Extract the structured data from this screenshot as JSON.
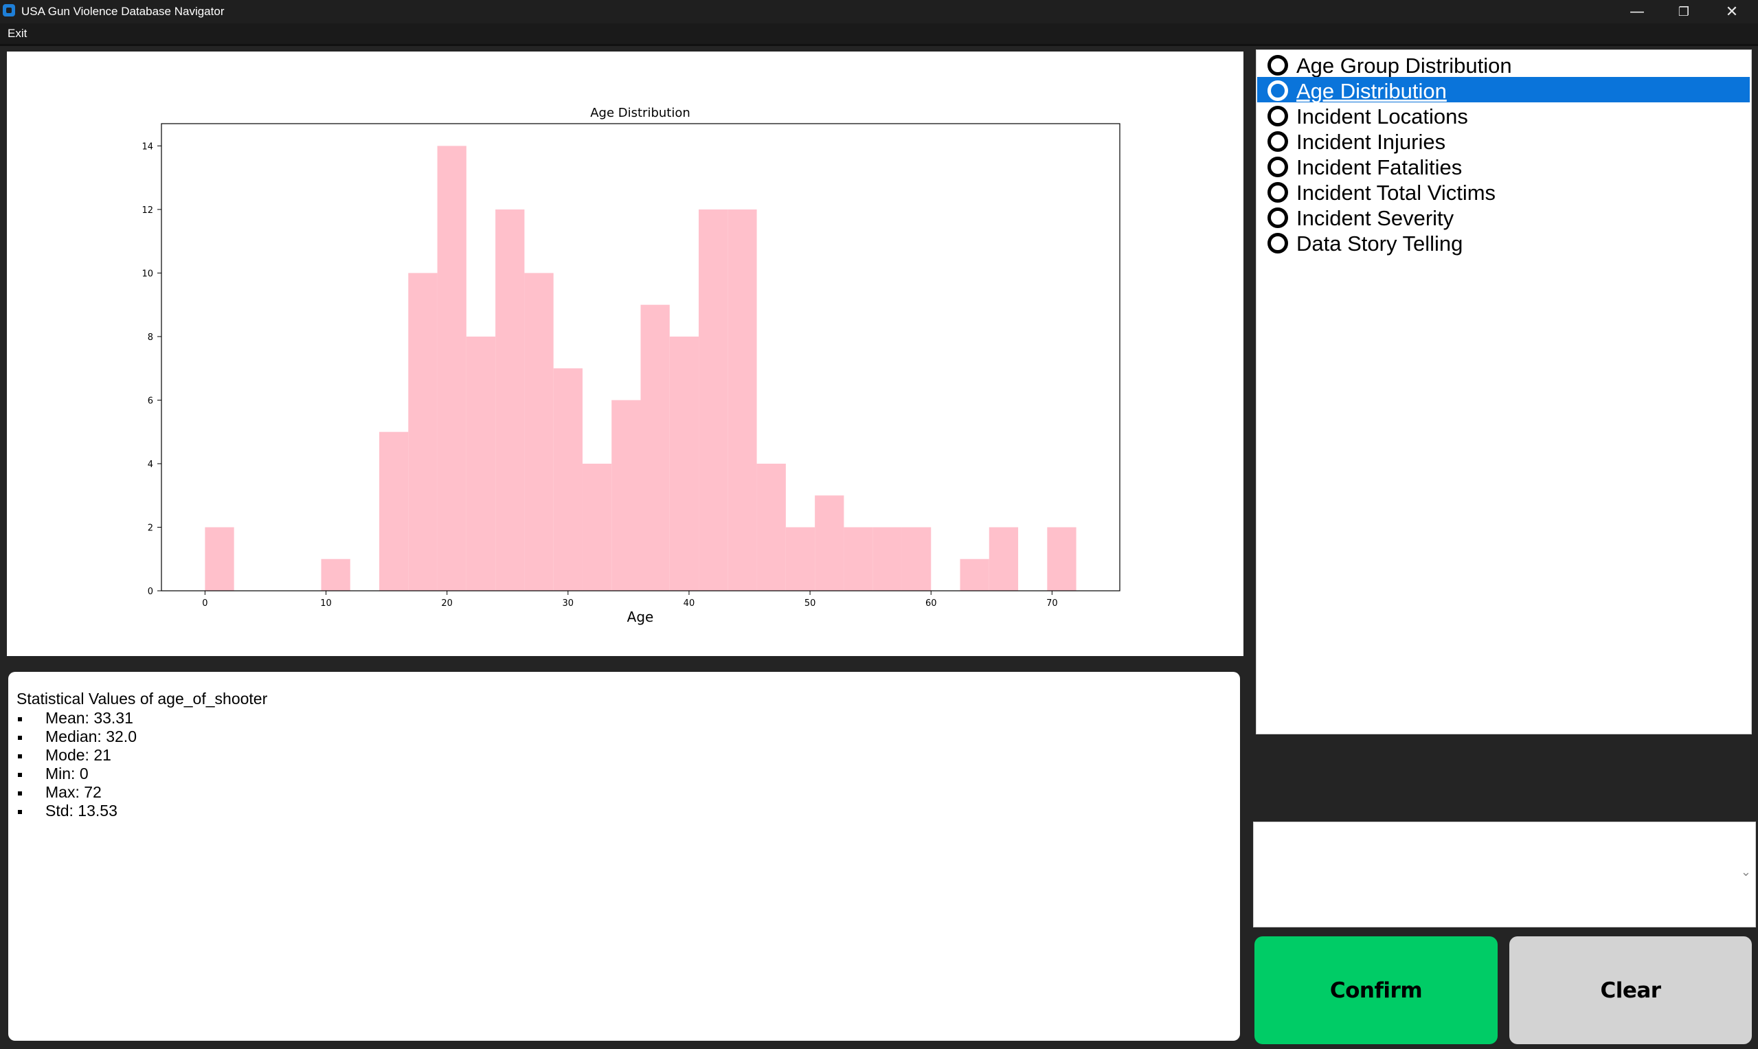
{
  "window": {
    "title": "USA Gun Violence Database Navigator",
    "controls": {
      "minimize": "—",
      "restore": "❐",
      "close": "✕"
    }
  },
  "menu": {
    "items": [
      {
        "label": "Exit"
      }
    ]
  },
  "chart_data": {
    "type": "bar",
    "title": "Age Distribution",
    "xlabel": "Age",
    "ylabel": "",
    "bar_color": "#ffc0cb",
    "bin_width": 2.4,
    "bins": [
      {
        "start": 0.0,
        "value": 2
      },
      {
        "start": 2.4,
        "value": 0
      },
      {
        "start": 4.8,
        "value": 0
      },
      {
        "start": 7.2,
        "value": 0
      },
      {
        "start": 9.6,
        "value": 1
      },
      {
        "start": 12.0,
        "value": 0
      },
      {
        "start": 14.4,
        "value": 5
      },
      {
        "start": 16.8,
        "value": 10
      },
      {
        "start": 19.2,
        "value": 14
      },
      {
        "start": 21.6,
        "value": 8
      },
      {
        "start": 24.0,
        "value": 12
      },
      {
        "start": 26.4,
        "value": 10
      },
      {
        "start": 28.8,
        "value": 7
      },
      {
        "start": 31.2,
        "value": 4
      },
      {
        "start": 33.6,
        "value": 6
      },
      {
        "start": 36.0,
        "value": 9
      },
      {
        "start": 38.4,
        "value": 8
      },
      {
        "start": 40.8,
        "value": 12
      },
      {
        "start": 43.2,
        "value": 12
      },
      {
        "start": 45.6,
        "value": 4
      },
      {
        "start": 48.0,
        "value": 2
      },
      {
        "start": 50.4,
        "value": 3
      },
      {
        "start": 52.8,
        "value": 2
      },
      {
        "start": 55.2,
        "value": 2
      },
      {
        "start": 57.6,
        "value": 2
      },
      {
        "start": 60.0,
        "value": 0
      },
      {
        "start": 62.4,
        "value": 1
      },
      {
        "start": 64.8,
        "value": 2
      },
      {
        "start": 67.2,
        "value": 0
      },
      {
        "start": 69.6,
        "value": 2
      }
    ],
    "xlim": [
      -3.6,
      75.6
    ],
    "ylim": [
      0,
      14.7
    ],
    "xticks": [
      0,
      10,
      20,
      30,
      40,
      50,
      60,
      70
    ],
    "yticks": [
      0,
      2,
      4,
      6,
      8,
      10,
      12,
      14
    ],
    "grid": false
  },
  "stats": {
    "title": "Statistical Values of age_of_shooter",
    "items": [
      "Mean: 33.31",
      "Median: 32.0",
      "Mode: 21",
      "Min: 0",
      "Max: 72",
      "Std: 13.53"
    ]
  },
  "options": {
    "items": [
      {
        "label": "Age Group Distribution",
        "selected": false
      },
      {
        "label": "Age Distribution",
        "selected": true
      },
      {
        "label": "Incident Locations",
        "selected": false
      },
      {
        "label": "Incident Injuries",
        "selected": false
      },
      {
        "label": "Incident Fatalities",
        "selected": false
      },
      {
        "label": "Incident Total Victims",
        "selected": false
      },
      {
        "label": "Incident Severity",
        "selected": false
      },
      {
        "label": "Data Story Telling",
        "selected": false
      }
    ],
    "selected_color": "#0a74da"
  },
  "dropdown": {
    "value": "",
    "icon": "chevron-down-icon"
  },
  "buttons": {
    "confirm": {
      "label": "Confirm",
      "color": "#00cc66"
    },
    "clear": {
      "label": "Clear",
      "color": "#d3d3d3"
    }
  }
}
